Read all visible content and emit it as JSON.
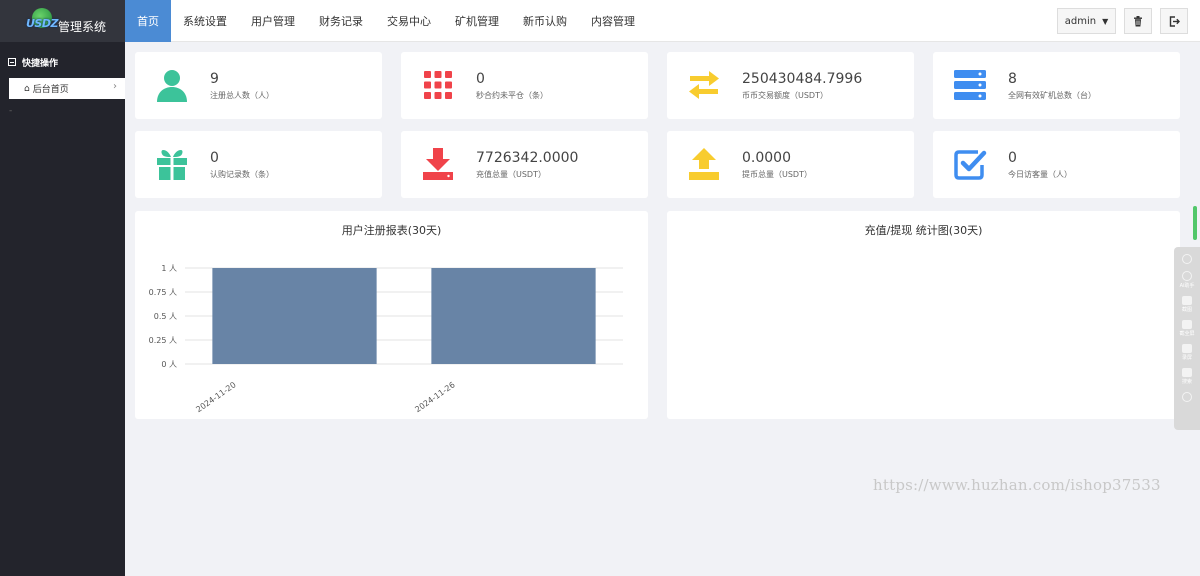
{
  "sidebar": {
    "logo_mark": "USDZ",
    "logo_title": "管理系统",
    "section_label": "快捷操作",
    "items": [
      {
        "label": "后台首页"
      }
    ],
    "dash": "-"
  },
  "nav": {
    "items": [
      {
        "label": "首页",
        "active": true
      },
      {
        "label": "系统设置"
      },
      {
        "label": "用户管理"
      },
      {
        "label": "财务记录"
      },
      {
        "label": "交易中心"
      },
      {
        "label": "矿机管理"
      },
      {
        "label": "新币认购"
      },
      {
        "label": "内容管理"
      }
    ],
    "user": "admin"
  },
  "stats": [
    {
      "value": "9",
      "label": "注册总人数（人）",
      "icon": "user-icon",
      "color": "#3cc39a"
    },
    {
      "value": "0",
      "label": "秒合约未平仓（条）",
      "icon": "grid-icon",
      "color": "#f0434a"
    },
    {
      "value": "250430484.7996",
      "label": "币币交易额度（USDT）",
      "icon": "exchange-icon",
      "color": "#f8cc2e"
    },
    {
      "value": "8",
      "label": "全网有效矿机总数（台）",
      "icon": "server-icon",
      "color": "#3f8df0"
    },
    {
      "value": "0",
      "label": "认购记录数（条）",
      "icon": "gift-icon",
      "color": "#3cc39a"
    },
    {
      "value": "7726342.0000",
      "label": "充值总量（USDT）",
      "icon": "download-icon",
      "color": "#f0434a"
    },
    {
      "value": "0.0000",
      "label": "提币总量（USDT）",
      "icon": "upload-icon",
      "color": "#f8cc2e"
    },
    {
      "value": "0",
      "label": "今日访客量（人）",
      "icon": "checkbox-icon",
      "color": "#3f8df0"
    }
  ],
  "charts": {
    "register_title": "用户注册报表(30天)",
    "finance_title": "充值/提现 统计图(30天)"
  },
  "chart_data": {
    "type": "bar",
    "title": "用户注册报表(30天)",
    "categories": [
      "2024-11-20",
      "2024-11-26"
    ],
    "values": [
      1,
      1
    ],
    "ylim": [
      0,
      1
    ],
    "yticks": [
      "0 人",
      "0.25 人",
      "0.5 人",
      "0.75 人",
      "1 人"
    ],
    "ytick_values": [
      0,
      0.25,
      0.5,
      0.75,
      1
    ],
    "bar_color": "#6884a6",
    "grid": true
  },
  "float_tools": [
    "Ai助手",
    "截图",
    "截全屏",
    "录屏",
    "搜索"
  ],
  "watermark": "https://www.huzhan.com/ishop37533"
}
